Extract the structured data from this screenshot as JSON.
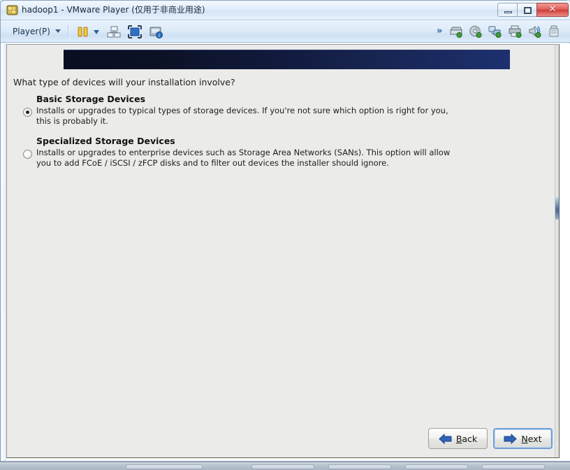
{
  "window": {
    "title": "hadoop1 - VMware Player (仅用于非商业用途)",
    "app_icon": "vmware-player-icon",
    "controls": {
      "minimize": "−",
      "maximize": "□",
      "close": "✕"
    }
  },
  "toolbar": {
    "player_menu_label": "Player(P)",
    "player_menu_caret": "chevron-down-icon",
    "left_icons": [
      {
        "name": "pause-vm-icon",
        "label": "Pause"
      },
      {
        "name": "pause-dropdown-caret",
        "label": "Pause options"
      },
      {
        "name": "unity-mode-icon",
        "label": "Unity"
      },
      {
        "name": "full-screen-icon",
        "label": "Enter Full Screen"
      },
      {
        "name": "send-ctrl-alt-del-icon",
        "label": "Send Ctrl+Alt+Del"
      }
    ],
    "overflow_label": "»",
    "right_icons": [
      {
        "name": "hard-disk-icon",
        "label": "Hard Disk"
      },
      {
        "name": "cd-dvd-icon",
        "label": "CD/DVD"
      },
      {
        "name": "network-adapter-icon",
        "label": "Network Adapter"
      },
      {
        "name": "printer-icon",
        "label": "Printer"
      },
      {
        "name": "sound-card-icon",
        "label": "Sound Card"
      },
      {
        "name": "usb-device-icon",
        "label": "USB Device"
      }
    ]
  },
  "installer": {
    "banner_color_start": "#090e20",
    "banner_color_end": "#1d3070",
    "question": "What type of devices will your installation involve?",
    "options": [
      {
        "title": "Basic Storage Devices",
        "description": "Installs or upgrades to typical types of storage devices.  If you're not sure which option is right for you, this is probably it.",
        "selected": true
      },
      {
        "title": "Specialized Storage Devices",
        "description": "Installs or upgrades to enterprise devices such as Storage Area Networks (SANs). This option will allow you to add FCoE / iSCSI / zFCP disks and to filter out devices the installer should ignore.",
        "selected": false
      }
    ],
    "buttons": {
      "back": {
        "prefix": "",
        "mnemonic": "B",
        "suffix": "ack",
        "icon": "arrow-left-icon",
        "focused": false
      },
      "next": {
        "prefix": "",
        "mnemonic": "N",
        "suffix": "ext",
        "icon": "arrow-right-icon",
        "focused": true
      }
    }
  }
}
